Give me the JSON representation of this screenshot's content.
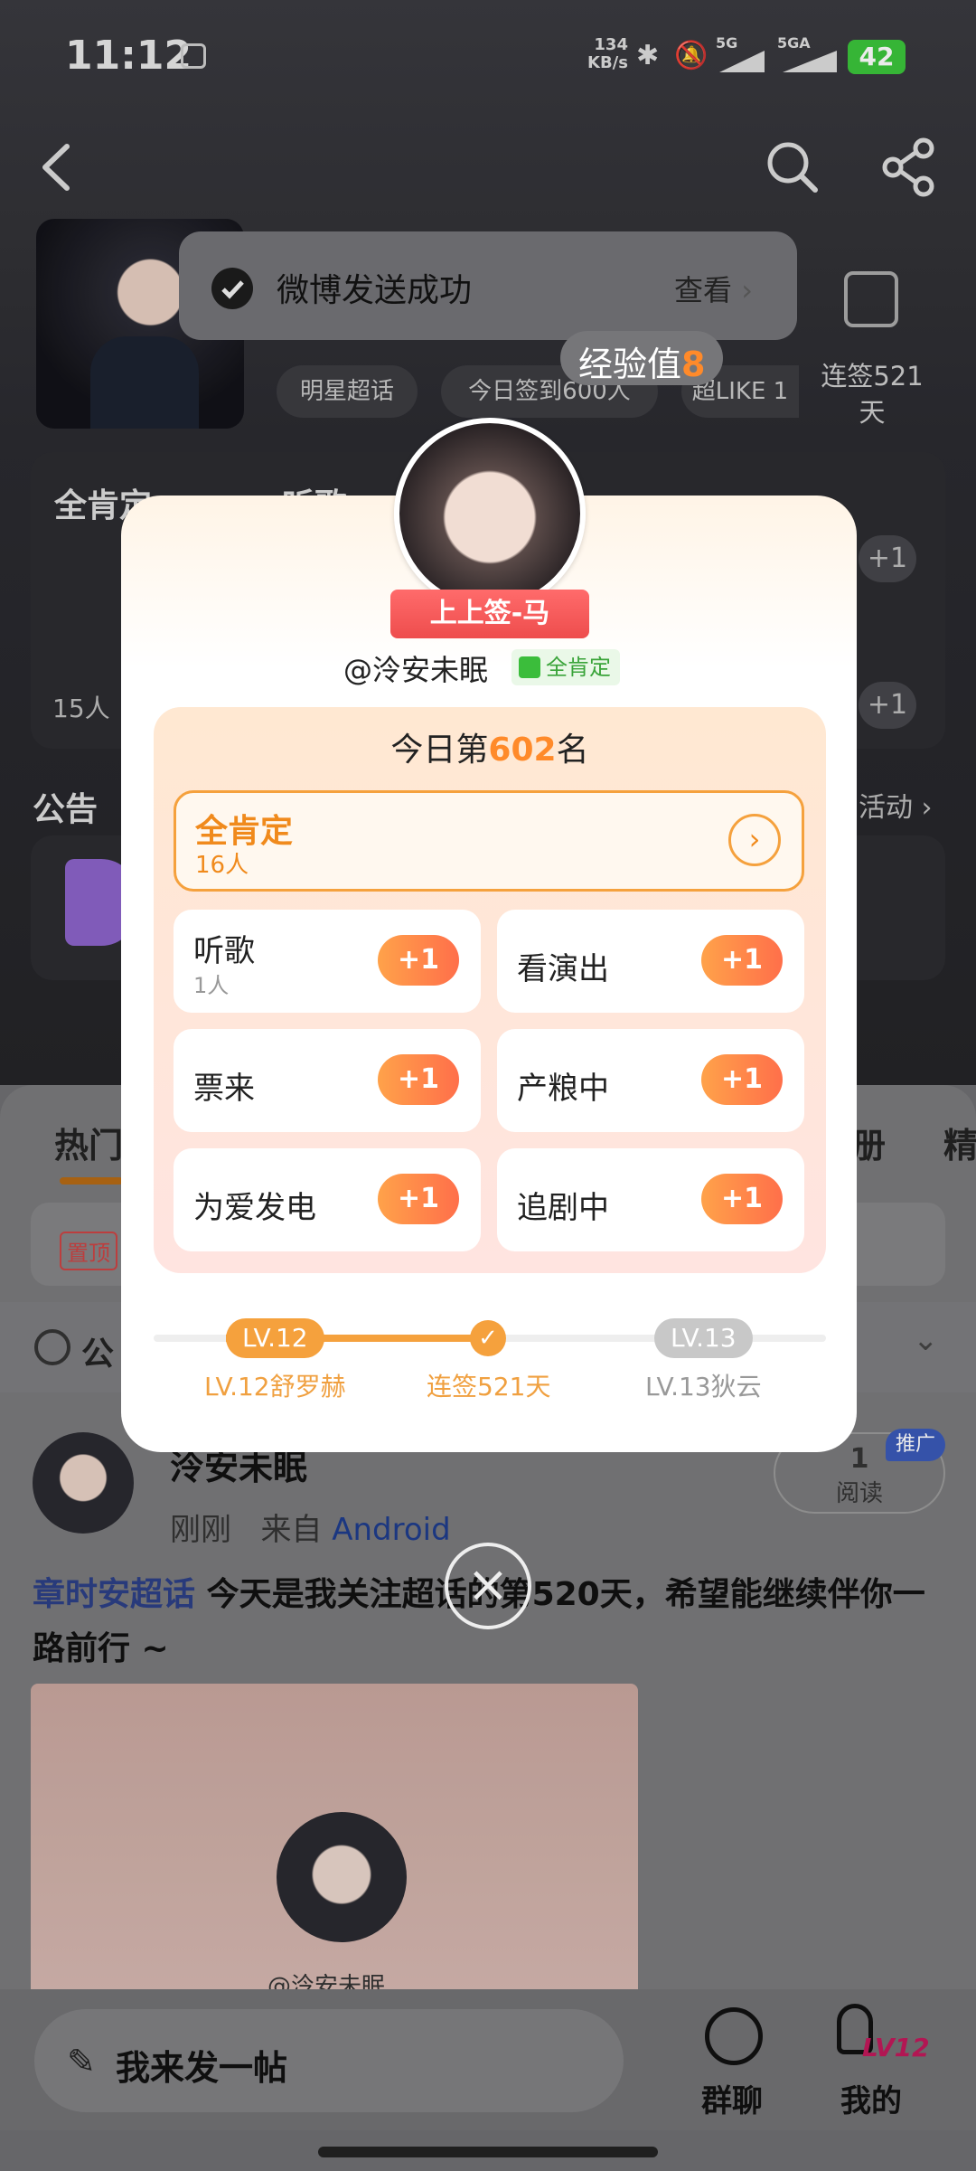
{
  "status_bar": {
    "time": "11:12",
    "net_speed_value": "134",
    "net_speed_unit": "KB/s",
    "net1": "5G",
    "net2": "5GA",
    "battery": "42"
  },
  "header": {
    "chips": [
      "明星超话",
      "今日签到600人",
      "超LIKE 1"
    ],
    "checkin_label": "连签521天"
  },
  "toast": {
    "message": "微博发送成功",
    "action": "查看"
  },
  "exp": {
    "label": "经验值",
    "value": "8"
  },
  "bg_tasks": {
    "first": "全肯定",
    "second": "听歌",
    "count": "15人",
    "plus": "+1"
  },
  "notice": {
    "title": "公告",
    "more": "活动"
  },
  "feed": {
    "tabs": [
      "热门",
      "册",
      "精"
    ],
    "pin": "置顶",
    "public": "公",
    "post": {
      "author": "泠安未眠",
      "time": "刚刚",
      "from_label": "来自",
      "source": "Android",
      "reads": "1",
      "reads_label": "阅读",
      "promo": "推广",
      "topic": "章时安超话",
      "text": "今天是我关注超话的第520天，希望能继续伴你一路前行 ~",
      "image_caption": "@泠安未眠"
    }
  },
  "bottom_nav": {
    "compose": "我来发一帖",
    "group_chat": "群聊",
    "mine": "我的",
    "level_badge": "LV12"
  },
  "modal": {
    "title_ribbon": "上上签-马",
    "username": "@泠安未眠",
    "badge": "全肯定",
    "rank_prefix": "今日第",
    "rank_number": "602",
    "rank_suffix": "名",
    "featured": {
      "label": "全肯定",
      "count": "16人"
    },
    "tasks": [
      {
        "label": "听歌",
        "count": "1人",
        "plus": "+1"
      },
      {
        "label": "看演出",
        "count": "",
        "plus": "+1"
      },
      {
        "label": "票来",
        "count": "",
        "plus": "+1"
      },
      {
        "label": "产粮中",
        "count": "",
        "plus": "+1"
      },
      {
        "label": "为爱发电",
        "count": "",
        "plus": "+1"
      },
      {
        "label": "追剧中",
        "count": "",
        "plus": "+1"
      }
    ],
    "level": {
      "current_badge": "LV.12",
      "next_badge": "LV.13",
      "current_label": "LV.12舒罗赫",
      "streak_label": "连签521天",
      "next_label": "LV.13狄云"
    }
  },
  "colors": {
    "accent": "#f5a13d",
    "plus_gradient_start": "#ffa24a",
    "plus_gradient_end": "#ff6f4a",
    "ribbon": "#ee4d4d",
    "topic": "#2c3f86"
  }
}
